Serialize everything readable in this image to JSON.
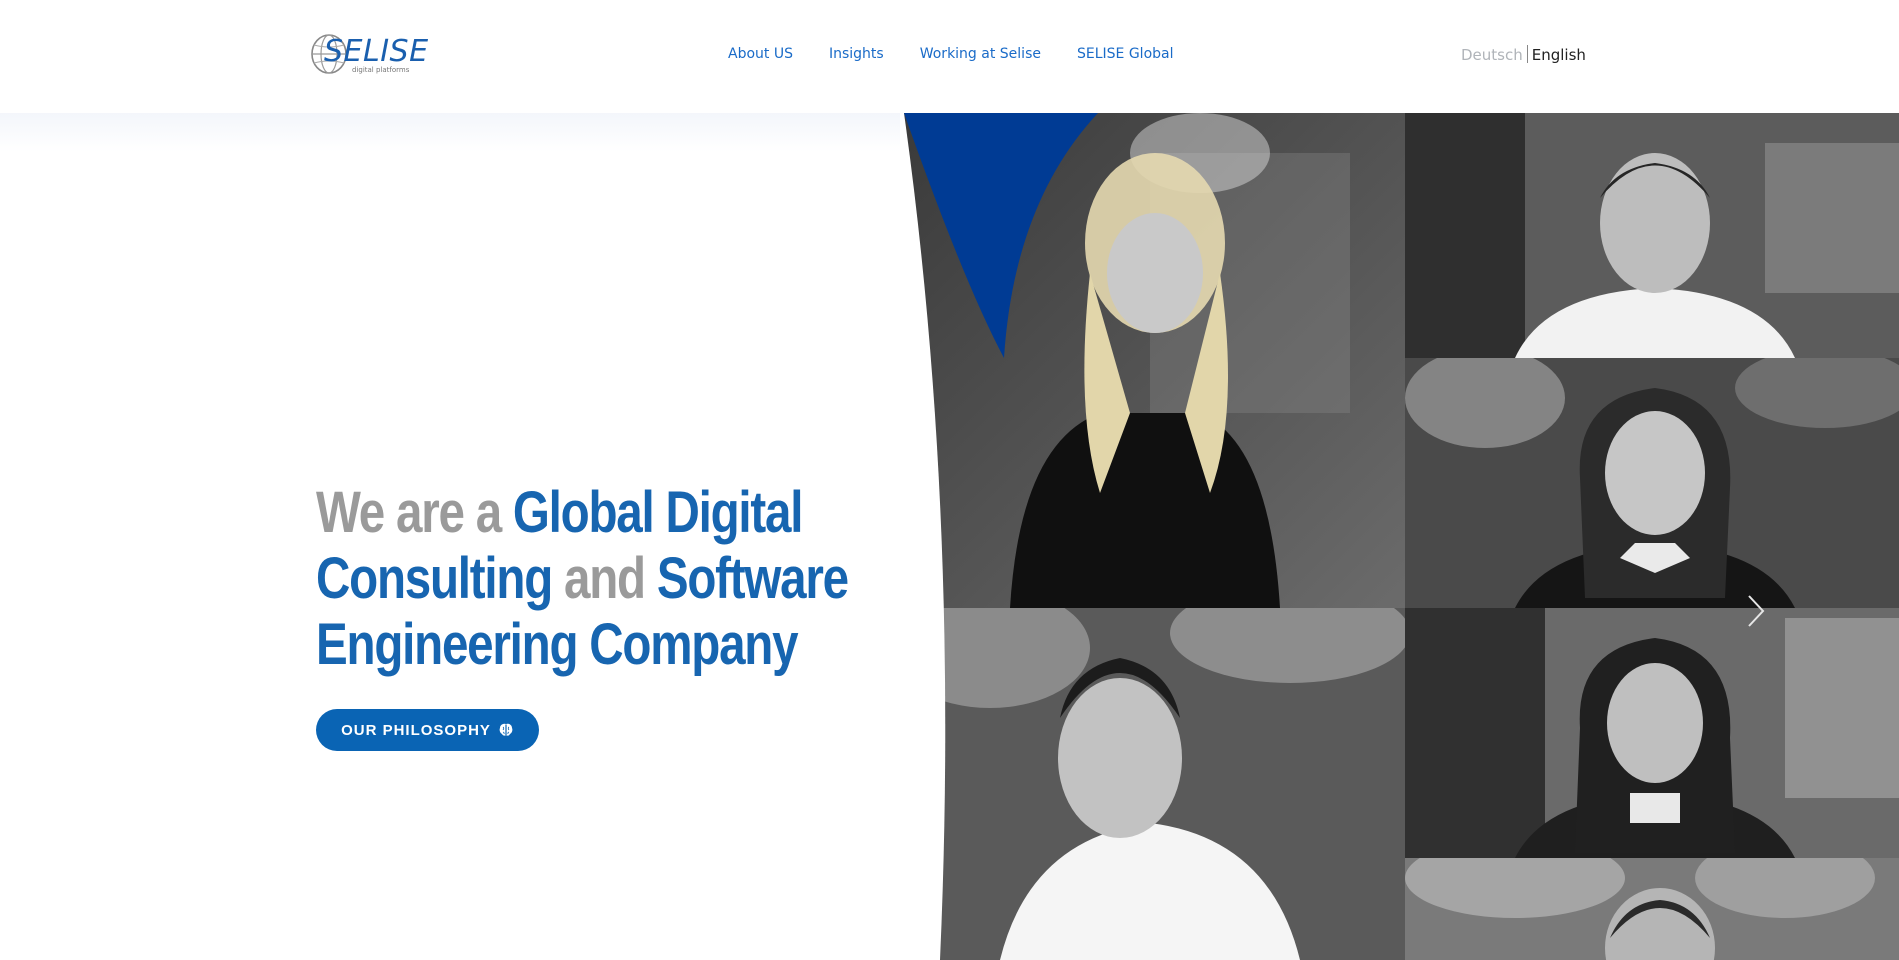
{
  "header": {
    "logo": {
      "word": "SELISE",
      "tagline": "digital platforms"
    },
    "nav": [
      {
        "label": "About US"
      },
      {
        "label": "Insights"
      },
      {
        "label": "Working at Selise"
      },
      {
        "label": "SELISE Global"
      }
    ],
    "lang": {
      "inactive": "Deutsch",
      "active": "English"
    }
  },
  "hero": {
    "h1_part1": "We are a ",
    "h1_part2": "Global Digital",
    "h1_part3": "Consulting",
    "h1_part4": " and ",
    "h1_part5": "Software",
    "h1_part6": "Engineering Company",
    "cta_label": "OUR PHILOSOPHY"
  },
  "slider": {
    "next_icon": "chevron-right-icon"
  },
  "colors": {
    "brand_blue": "#0a64b4",
    "wedge_blue": "#003b94",
    "muted_gray": "#9a9a9a"
  }
}
